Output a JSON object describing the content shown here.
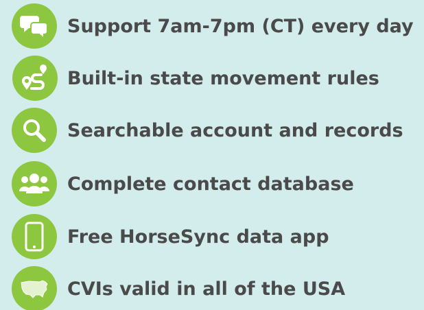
{
  "features": [
    {
      "label": "Support 7am-7pm (CT) every day",
      "icon": "chat-bubbles-icon"
    },
    {
      "label": "Built-in state movement rules",
      "icon": "route-pin-icon"
    },
    {
      "label": "Searchable account and records",
      "icon": "magnifier-icon"
    },
    {
      "label": "Complete contact database",
      "icon": "people-group-icon"
    },
    {
      "label": "Free HorseSync data app",
      "icon": "smartphone-icon"
    },
    {
      "label": "CVIs valid in all of the USA",
      "icon": "usa-map-icon"
    }
  ],
  "colors": {
    "background": "#d3ecec",
    "icon_circle": "#8dc63f",
    "text": "#4a4a4a"
  }
}
